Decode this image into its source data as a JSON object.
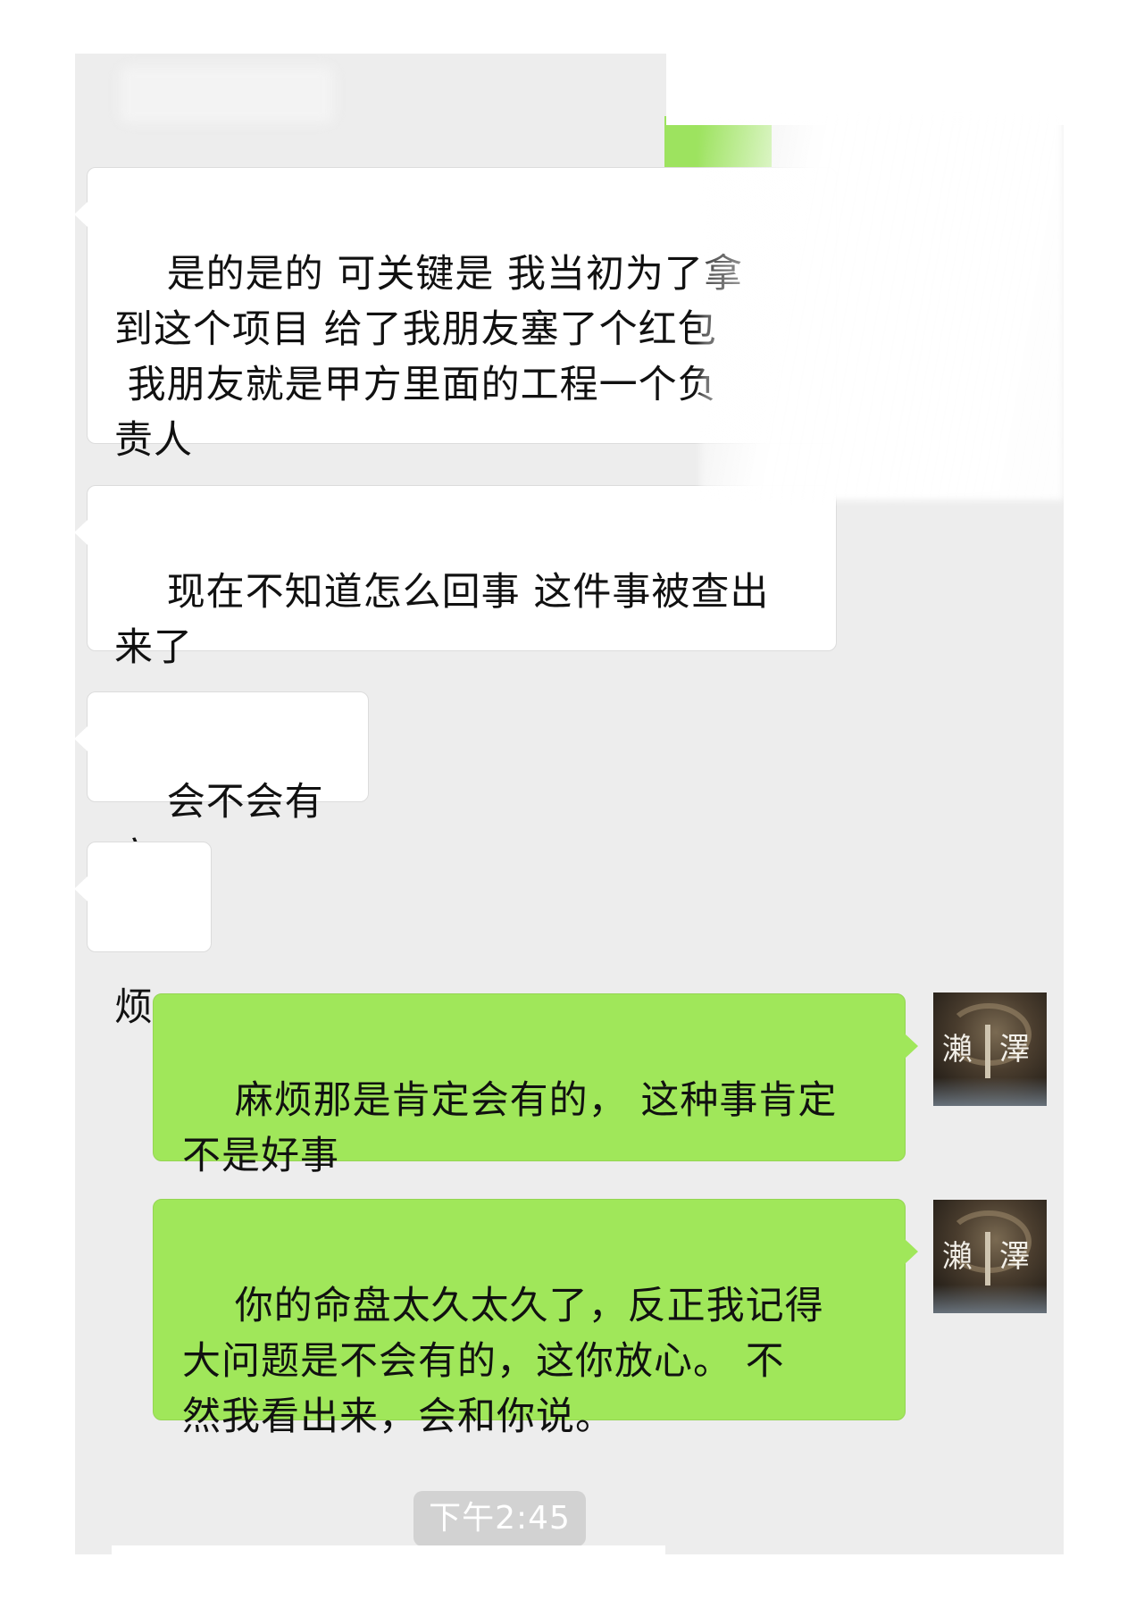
{
  "messages": [
    {
      "side": "incoming",
      "text": "是的是的 可关键是 我当初为了拿\n到这个项目 给了我朋友塞了个红包\n 我朋友就是甲方里面的工程一个负\n责人"
    },
    {
      "side": "incoming",
      "text": "现在不知道怎么回事 这件事被查出\n来了"
    },
    {
      "side": "incoming",
      "text": "会不会有麻"
    },
    {
      "side": "incoming",
      "text": "烦"
    },
    {
      "side": "outgoing",
      "text": "麻烦那是肯定会有的， 这种事肯定\n不是好事"
    },
    {
      "side": "outgoing",
      "text": "你的命盘太久太久了，反正我记得\n大问题是不会有的，这你放心。 不\n然我看出来，会和你说。"
    }
  ],
  "avatar": {
    "glyph_left": "瀨",
    "glyph_right": "澤"
  },
  "timestamp": "下午2:45",
  "colors": {
    "background": "#ededed",
    "incoming_bubble": "#ffffff",
    "outgoing_bubble": "#a0e75a",
    "timestamp_badge": "#d2d2d2"
  }
}
